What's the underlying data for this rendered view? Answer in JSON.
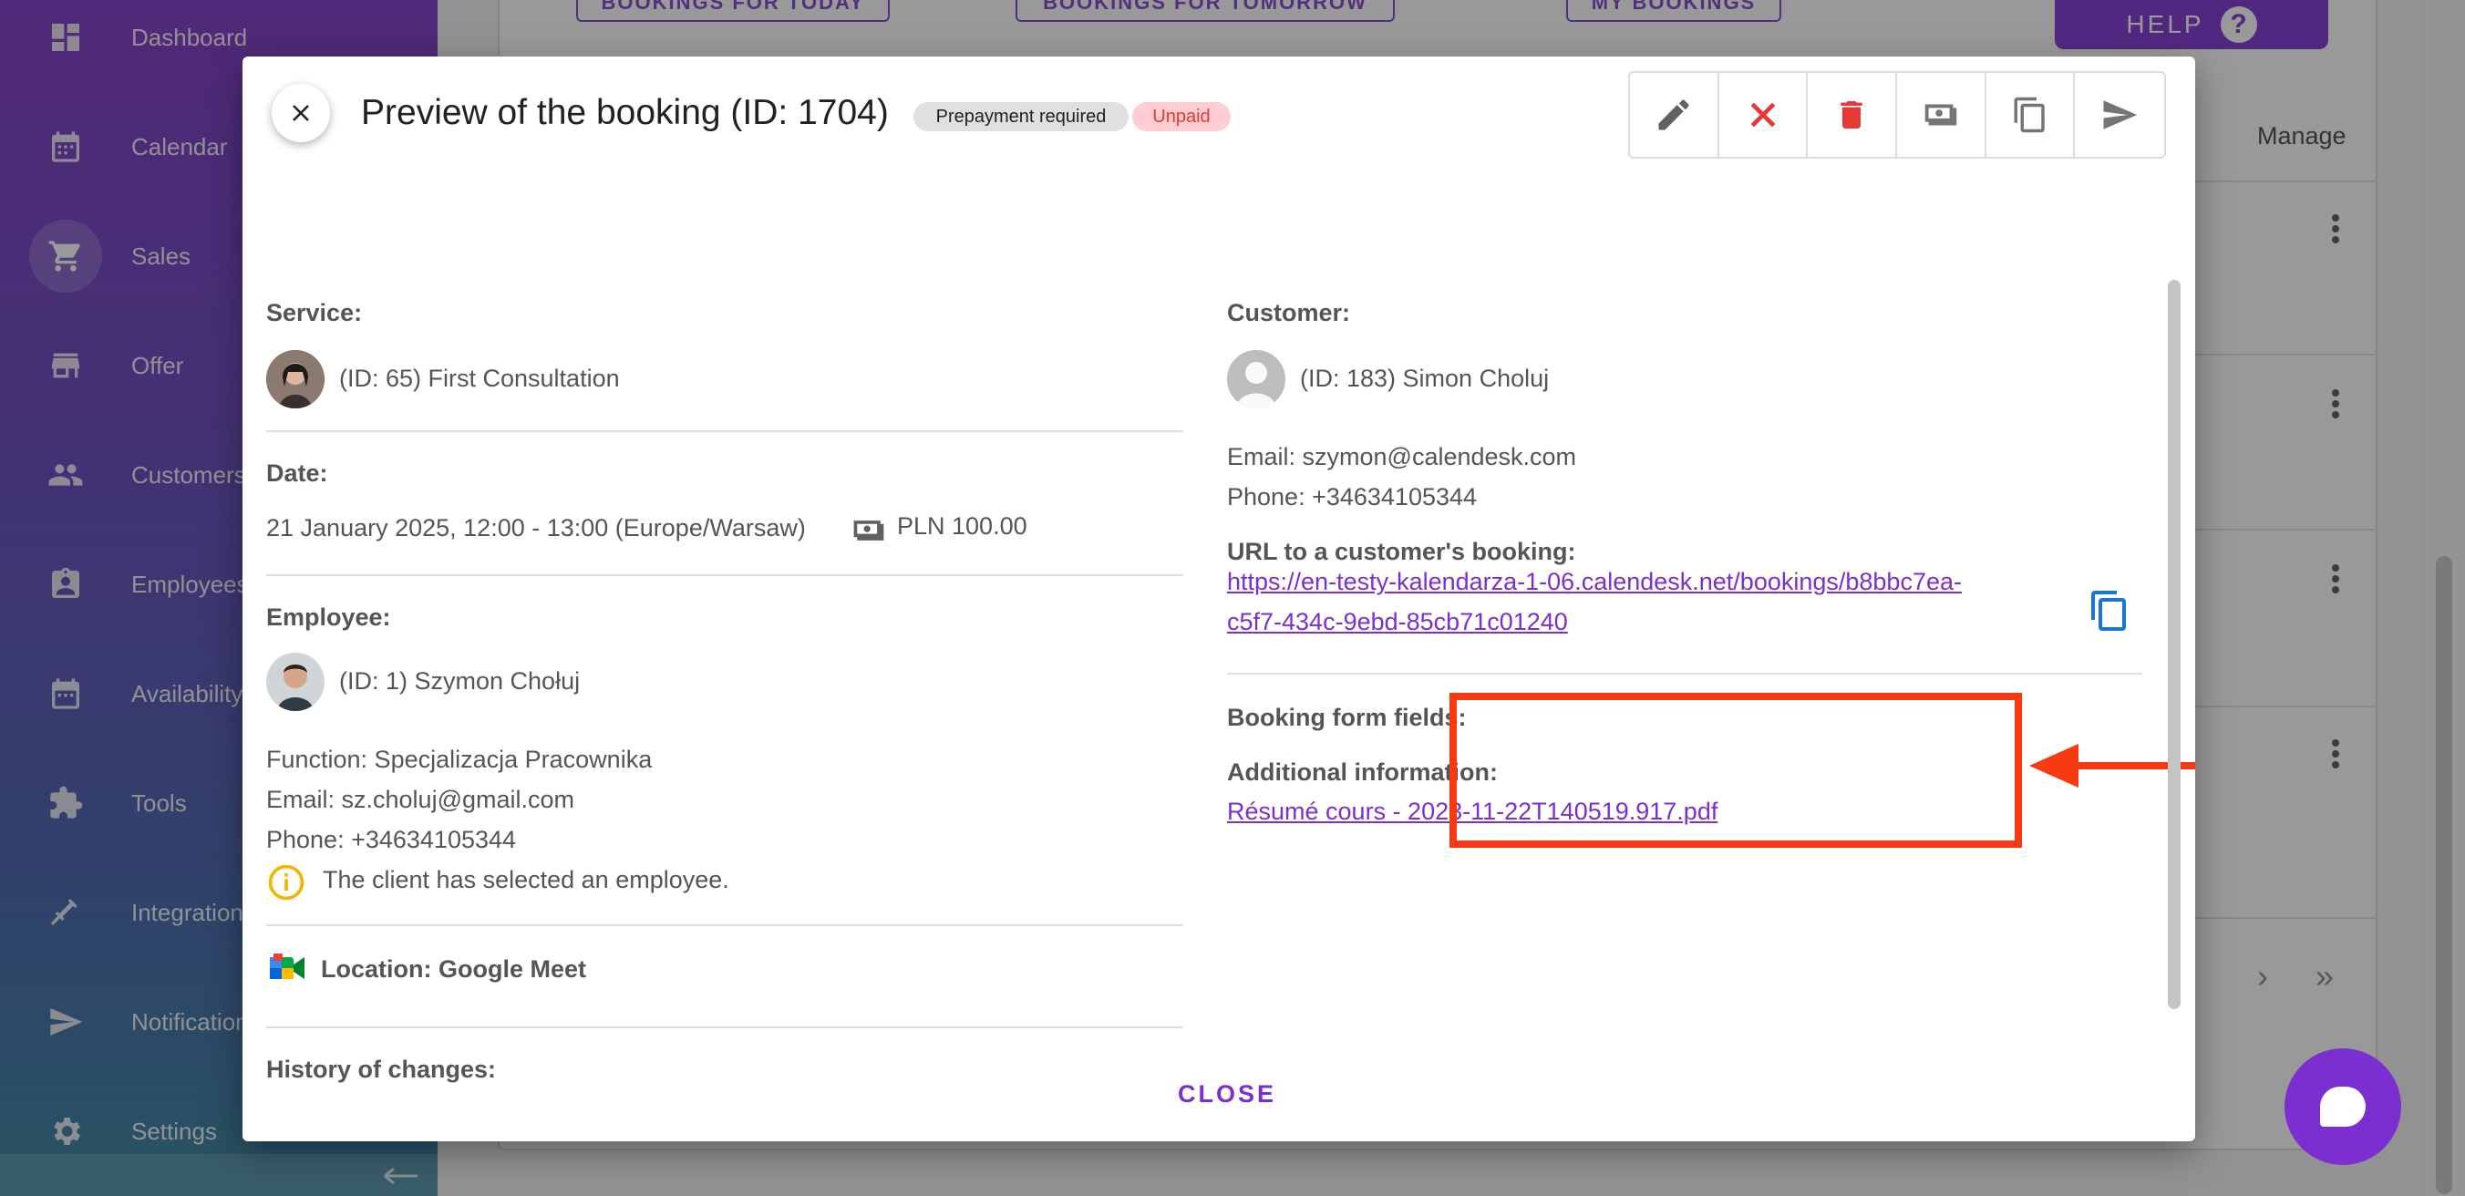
{
  "sidebar": {
    "items": [
      {
        "label": "Dashboard",
        "icon": "dashboard-icon"
      },
      {
        "label": "Calendar",
        "icon": "calendar-icon"
      },
      {
        "label": "Sales",
        "icon": "cart-icon"
      },
      {
        "label": "Offer",
        "icon": "store-icon"
      },
      {
        "label": "Customers",
        "icon": "people-icon"
      },
      {
        "label": "Employees",
        "icon": "badge-icon"
      },
      {
        "label": "Availability",
        "icon": "calendar-clock-icon"
      },
      {
        "label": "Tools",
        "icon": "puzzle-icon"
      },
      {
        "label": "Integrations",
        "icon": "plug-icon"
      },
      {
        "label": "Notifications",
        "icon": "send-icon"
      },
      {
        "label": "Settings",
        "icon": "gear-icon"
      }
    ],
    "active": "Sales"
  },
  "background": {
    "buttons": [
      "BOOKINGS FOR TODAY",
      "BOOKINGS FOR TOMORROW",
      "MY BOOKINGS"
    ],
    "help_label": "HELP",
    "manage_header": "Manage"
  },
  "dialog": {
    "title": "Preview of the booking (ID: 1704)",
    "chips": {
      "prepayment": "Prepayment required",
      "status": "Unpaid"
    },
    "toolbar": [
      "edit-icon",
      "cancel-icon",
      "delete-icon",
      "payment-icon",
      "duplicate-icon",
      "send-icon"
    ],
    "service": {
      "label": "Service:",
      "value": "(ID: 65) First Consultation"
    },
    "date": {
      "label": "Date:",
      "value": "21 January 2025, 12:00 - 13:00 (Europe/Warsaw)",
      "price": "PLN 100.00"
    },
    "employee": {
      "label": "Employee:",
      "name": "(ID: 1) Szymon Chołuj",
      "function": "Function: Specjalizacja Pracownika",
      "email": "Email: sz.choluj@gmail.com",
      "phone": "Phone: +34634105344",
      "info": "The client has selected an employee."
    },
    "location": "Location: Google Meet",
    "history_label": "History of changes:",
    "customer": {
      "label": "Customer:",
      "name": "(ID: 183) Simon Choluj",
      "email": "Email: szymon@calendesk.com",
      "phone": "Phone: +34634105344",
      "url_label": "URL to a customer's booking:",
      "url_line1": "https://en-testy-kalendarza-1-06.calendesk.net/bookings/b8bbc7ea-",
      "url_line2": "c5f7-434c-9ebd-85cb71c01240"
    },
    "form_fields": {
      "label": "Booking form fields:",
      "additional_label": "Additional information:",
      "file": "Résumé cours - 2023-11-22T140519.917.pdf"
    },
    "close_label": "CLOSE"
  },
  "colors": {
    "accent": "#7b2fd0",
    "danger": "#e53935",
    "highlight": "#f83a12"
  }
}
